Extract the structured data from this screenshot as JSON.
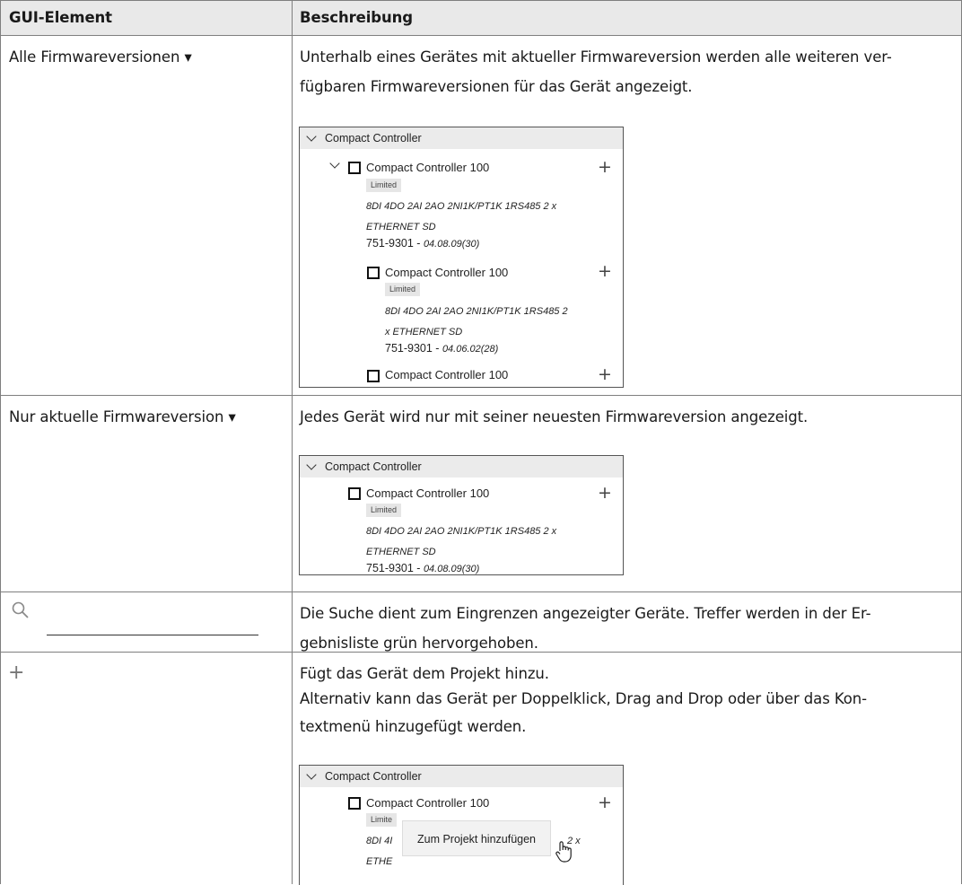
{
  "table": {
    "header": {
      "col1": "GUI-Element",
      "col2": "Beschreibung"
    },
    "rows": [
      {
        "element": "Alle Firmwareversionen ▾",
        "desc_line1": "Unterhalb eines Gerätes mit aktueller Firmwareversion werden alle weiteren ver-",
        "desc_line2": "fügbaren Firmwareversionen für das Gerät angezeigt."
      },
      {
        "element": "Nur aktuelle Firmwareversion ▾",
        "desc_line1": "Jedes Gerät wird nur mit seiner neuesten Firmwareversion angezeigt."
      },
      {
        "element": "",
        "desc_line1": "Die Suche dient zum Eingrenzen angezeigter Geräte. Treffer werden in der Er-",
        "desc_line2": "gebnisliste grün hervorgehoben."
      },
      {
        "element": "+",
        "desc_line1": "Fügt das Gerät dem Projekt hinzu.",
        "desc_line2": "Alternativ kann das Gerät per Doppelklick, Drag and Drop oder über das Kon-",
        "desc_line3": "textmenü hinzugefügt werden."
      }
    ]
  },
  "shot1": {
    "group": "Compact Controller",
    "dev1": {
      "name": "Compact Controller 100",
      "tag": "Limited",
      "desc1": "8DI 4DO 2AI 2AO 2NI1K/PT1K 1RS485 2 x",
      "desc2": "ETHERNET SD",
      "code": "751-9301 - ",
      "version": "04.08.09(30)"
    },
    "dev2": {
      "name": "Compact Controller 100",
      "tag": "Limited",
      "desc1": "8DI 4DO 2AI 2AO 2NI1K/PT1K 1RS485 2",
      "desc2": "x ETHERNET SD",
      "code": "751-9301 - ",
      "version": "04.06.02(28)"
    },
    "dev3": {
      "name": "Compact Controller 100"
    }
  },
  "shot2": {
    "group": "Compact Controller",
    "dev1": {
      "name": "Compact Controller 100",
      "tag": "Limited",
      "desc1": "8DI 4DO 2AI 2AO 2NI1K/PT1K 1RS485 2 x",
      "desc2": "ETHERNET SD",
      "code": "751-9301 - ",
      "version": "04.08.09(30)"
    }
  },
  "shot3": {
    "group": "Compact Controller",
    "dev1": {
      "name": "Compact Controller 100",
      "tag": "Limite",
      "desc1": "8DI 4I",
      "desc2": "ETHE",
      "desc_tail": "2 x"
    },
    "context_menu": "Zum Projekt hinzufügen"
  },
  "icons": {
    "plus": "+"
  }
}
